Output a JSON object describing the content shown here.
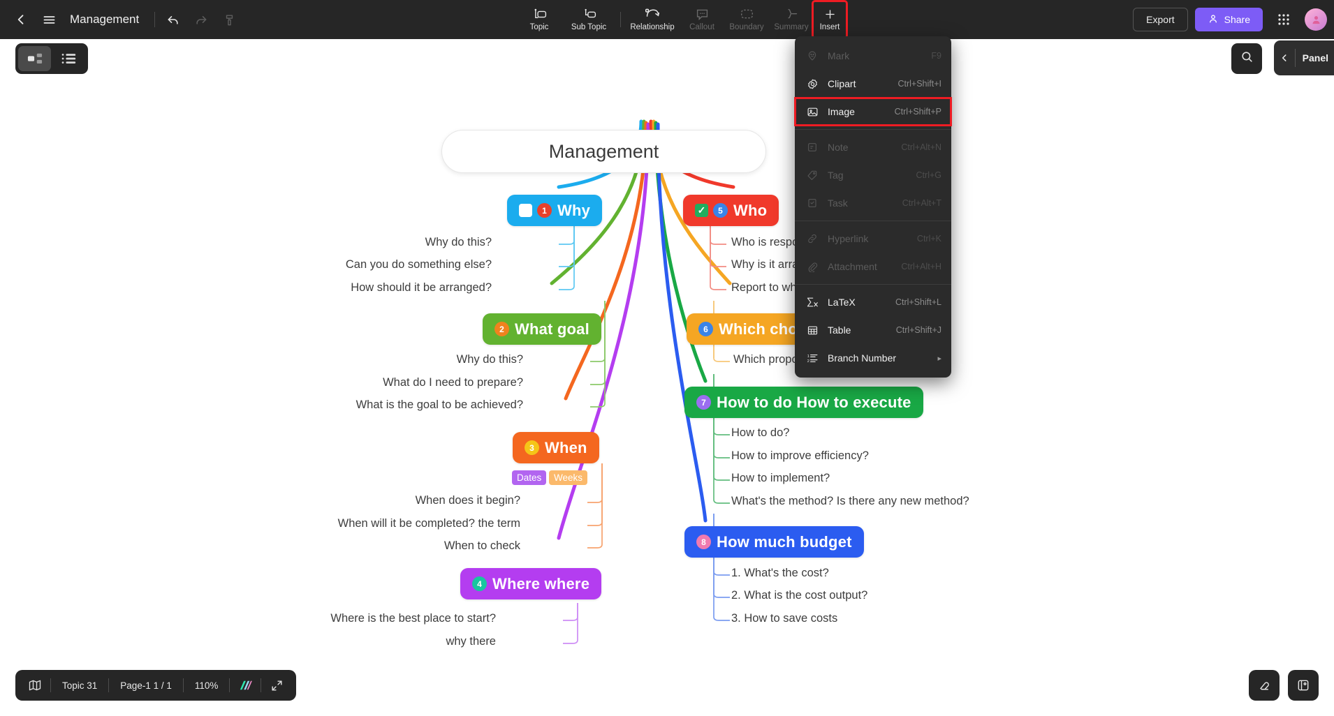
{
  "topbar": {
    "back_icon": "chevron-left-icon",
    "menu_icon": "hamburger-menu-icon",
    "doc_title": "Management",
    "undo_icon": "undo-icon",
    "redo_icon": "redo-icon",
    "format_painter_icon": "format-painter-icon",
    "tools": [
      {
        "label": "Topic",
        "icon": "topic-icon",
        "disabled": false
      },
      {
        "label": "Sub Topic",
        "icon": "sub-topic-icon",
        "disabled": false
      },
      {
        "label": "Relationship",
        "icon": "relationship-icon",
        "disabled": false
      },
      {
        "label": "Callout",
        "icon": "callout-icon",
        "disabled": true
      },
      {
        "label": "Boundary",
        "icon": "boundary-icon",
        "disabled": true
      },
      {
        "label": "Summary",
        "icon": "summary-icon",
        "disabled": true
      },
      {
        "label": "Insert",
        "icon": "plus-icon",
        "disabled": false
      }
    ],
    "export_label": "Export",
    "share_label": "Share",
    "share_icon": "person-icon",
    "apps_icon": "grid-apps-icon",
    "avatar_icon": "user-avatar"
  },
  "view_toggle": {
    "mindmap_icon": "mindmap-view-icon",
    "outline_icon": "outline-view-icon",
    "active": "mindmap"
  },
  "search": {
    "icon": "search-icon"
  },
  "right_panel": {
    "collapse_icon": "chevron-left-icon",
    "label": "Panel"
  },
  "insert_menu": {
    "items": [
      {
        "label": "Mark",
        "shortcut": "F9",
        "icon": "mark-icon",
        "disabled": true,
        "highlighted": false
      },
      {
        "label": "Clipart",
        "shortcut": "Ctrl+Shift+I",
        "icon": "clipart-icon",
        "disabled": false,
        "highlighted": false
      },
      {
        "label": "Image",
        "shortcut": "Ctrl+Shift+P",
        "icon": "image-icon",
        "disabled": false,
        "highlighted": true
      },
      {
        "label": "Note",
        "shortcut": "Ctrl+Alt+N",
        "icon": "note-icon",
        "disabled": true,
        "highlighted": false
      },
      {
        "label": "Tag",
        "shortcut": "Ctrl+G",
        "icon": "tag-icon",
        "disabled": true,
        "highlighted": false
      },
      {
        "label": "Task",
        "shortcut": "Ctrl+Alt+T",
        "icon": "task-icon",
        "disabled": true,
        "highlighted": false
      },
      {
        "label": "Hyperlink",
        "shortcut": "Ctrl+K",
        "icon": "hyperlink-icon",
        "disabled": true,
        "highlighted": false
      },
      {
        "label": "Attachment",
        "shortcut": "Ctrl+Alt+H",
        "icon": "attachment-icon",
        "disabled": true,
        "highlighted": false
      },
      {
        "label": "LaTeX",
        "shortcut": "Ctrl+Shift+L",
        "icon": "latex-icon",
        "disabled": false,
        "highlighted": false
      },
      {
        "label": "Table",
        "shortcut": "Ctrl+Shift+J",
        "icon": "table-icon",
        "disabled": false,
        "highlighted": false
      },
      {
        "label": "Branch Number",
        "shortcut": "",
        "icon": "branch-number-icon",
        "disabled": false,
        "highlighted": false,
        "submenu": true
      }
    ],
    "highlight_color": "#ee1c23"
  },
  "mindmap": {
    "root": {
      "title": "Management"
    },
    "branches": [
      {
        "id": "why",
        "title": "Why",
        "badge": "1",
        "badge_color": "#e8412c",
        "color": "#1bacee",
        "side": "left",
        "checkbox": "unchecked",
        "children": [
          "Why do this?",
          "Can you do something else?",
          "How should it be arranged?"
        ]
      },
      {
        "id": "what-goal",
        "title": "What goal",
        "badge": "2",
        "badge_color": "#f0821e",
        "color": "#62b230",
        "side": "left",
        "children": [
          "Why do this?",
          "What do I need to prepare?",
          "What is the goal to be achieved?"
        ]
      },
      {
        "id": "when",
        "title": "When",
        "badge": "3",
        "badge_color": "#f5c518",
        "color": "#f4671f",
        "side": "left",
        "tags": [
          {
            "label": "Dates",
            "color": "#b265f0"
          },
          {
            "label": "Weeks",
            "color": "#fbb96b"
          }
        ],
        "children": [
          "When does it begin?",
          "When will it be completed? the term",
          "When to check"
        ]
      },
      {
        "id": "where",
        "title": "Where where",
        "badge": "4",
        "badge_color": "#19c6a0",
        "color": "#b43df0",
        "side": "left",
        "children": [
          "Where is the best place to start?",
          "why there"
        ]
      },
      {
        "id": "who",
        "title": "Who",
        "badge": "5",
        "badge_color": "#3a84e8",
        "color": "#f0392b",
        "side": "right",
        "checkbox": "checked",
        "children": [
          "Who is responsible?",
          "Why is it arranged?",
          "Report to who?"
        ]
      },
      {
        "id": "which",
        "title": "Which choice",
        "badge": "6",
        "badge_color": "#3a84e8",
        "color": "#f5a623",
        "side": "right",
        "children": [
          "Which proposal?"
        ]
      },
      {
        "id": "how-to-do",
        "title": "How to do How to execute",
        "badge": "7",
        "badge_color": "#9b6ef0",
        "color": "#19a845",
        "side": "right",
        "children": [
          "How to do?",
          "How to improve efficiency?",
          "How to implement?",
          "What's the method? Is there any new method?"
        ]
      },
      {
        "id": "budget",
        "title": "How much budget",
        "badge": "8",
        "badge_color": "#f07ab0",
        "color": "#2b5cf0",
        "side": "right",
        "children": [
          "1. What's the cost?",
          "2. What is the cost output?",
          "3. How to save costs"
        ]
      }
    ]
  },
  "statusbar": {
    "map_icon": "map-overview-icon",
    "topic_count": "Topic 31",
    "page_label": "Page-1  1 / 1",
    "zoom_level": "110%",
    "theme_icon": "theme-color-icon",
    "fullscreen_icon": "fullscreen-icon"
  },
  "corner_buttons": [
    {
      "icon": "eraser-icon"
    },
    {
      "icon": "sticker-icon"
    }
  ]
}
